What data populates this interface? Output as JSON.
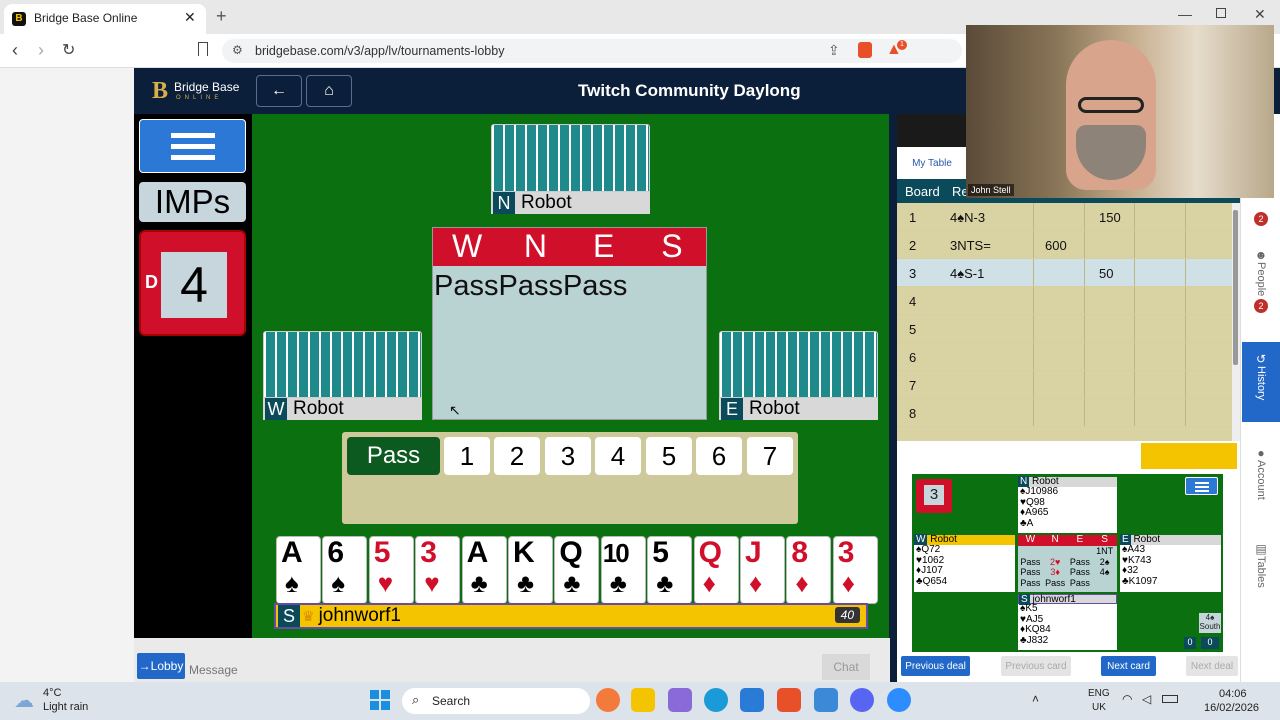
{
  "browser": {
    "tab_title": "Bridge Base Online",
    "url": "bridgebase.com/v3/app/lv/tournaments-lobby",
    "ext_badge": "1"
  },
  "header": {
    "logo": "Bridge Base",
    "logo_sub": "ONLINE",
    "title": "Twitch Community Daylong",
    "back_icon": "←",
    "home_icon": "⌂"
  },
  "left": {
    "scoring": "IMPs",
    "board_number": "4",
    "dealer": "D"
  },
  "table": {
    "north": {
      "seat": "N",
      "name": "Robot"
    },
    "west": {
      "seat": "W",
      "name": "Robot"
    },
    "east": {
      "seat": "E",
      "name": "Robot"
    },
    "south": {
      "seat": "S",
      "name": "johnworf1",
      "score": "40"
    },
    "auction_headers": [
      "W",
      "N",
      "E",
      "S"
    ],
    "auction_text": "PassPassPass"
  },
  "bidbox": {
    "pass": "Pass",
    "levels": [
      "1",
      "2",
      "3",
      "4",
      "5",
      "6",
      "7"
    ]
  },
  "hand": [
    {
      "rank": "A",
      "suit": "♠",
      "color": "blk"
    },
    {
      "rank": "6",
      "suit": "♠",
      "color": "blk"
    },
    {
      "rank": "5",
      "suit": "♥",
      "color": "red"
    },
    {
      "rank": "3",
      "suit": "♥",
      "color": "red"
    },
    {
      "rank": "A",
      "suit": "♣",
      "color": "blk"
    },
    {
      "rank": "K",
      "suit": "♣",
      "color": "blk"
    },
    {
      "rank": "Q",
      "suit": "♣",
      "color": "blk"
    },
    {
      "rank": "10",
      "suit": "♣",
      "color": "blk"
    },
    {
      "rank": "5",
      "suit": "♣",
      "color": "blk"
    },
    {
      "rank": "Q",
      "suit": "♦",
      "color": "red"
    },
    {
      "rank": "J",
      "suit": "♦",
      "color": "red"
    },
    {
      "rank": "8",
      "suit": "♦",
      "color": "red"
    },
    {
      "rank": "3",
      "suit": "♦",
      "color": "red"
    }
  ],
  "bottom": {
    "lobby": "→Lobby",
    "message_placeholder": "Message",
    "chat": "Chat"
  },
  "history": {
    "tab": "My Table",
    "col_board": "Board",
    "col_result": "Re",
    "rows": [
      {
        "board": "1",
        "result": "4♠N-3",
        "ns": "",
        "ew": "150"
      },
      {
        "board": "2",
        "result": "3NTS=",
        "ns": "600",
        "ew": ""
      },
      {
        "board": "3",
        "result": "4♠S-1",
        "ns": "",
        "ew": "50"
      },
      {
        "board": "4",
        "result": "",
        "ns": "",
        "ew": ""
      },
      {
        "board": "5",
        "result": "",
        "ns": "",
        "ew": ""
      },
      {
        "board": "6",
        "result": "",
        "ns": "",
        "ew": ""
      },
      {
        "board": "7",
        "result": "",
        "ns": "",
        "ew": ""
      },
      {
        "board": "8",
        "result": "",
        "ns": "",
        "ew": ""
      }
    ]
  },
  "replay": {
    "board": "3",
    "north": {
      "seat": "N",
      "name": "Robot",
      "lines": [
        "♠J10986",
        "♥Q98",
        "♦A965",
        "♣A"
      ]
    },
    "west": {
      "seat": "W",
      "name": "Robot",
      "lines": [
        "♠Q72",
        "♥1062",
        "♦J107",
        "♣Q654"
      ]
    },
    "east": {
      "seat": "E",
      "name": "Robot",
      "lines": [
        "♠A43",
        "♥K743",
        "♦32",
        "♣K1097"
      ]
    },
    "south": {
      "seat": "S",
      "name": "johnworf1",
      "lines": [
        "♠K5",
        "♥AJ5",
        "♦KQ84",
        "♣J832"
      ]
    },
    "auction_headers": [
      "W",
      "N",
      "E",
      "S"
    ],
    "auction_rows": [
      [
        "",
        "",
        "",
        "1NT"
      ],
      [
        "Pass",
        "2♥",
        "Pass",
        "2♠"
      ],
      [
        "Pass",
        "3♦",
        "Pass",
        "4♠"
      ],
      [
        "Pass",
        "Pass",
        "Pass",
        ""
      ]
    ],
    "contract": "4♠",
    "declarer": "South",
    "tricks_ns": "0",
    "tricks_ew": "0",
    "prev_deal": "Previous deal",
    "prev_card": "Previous card",
    "next_card": "Next card",
    "next_deal": "Next deal"
  },
  "sidetabs": {
    "people": "People",
    "people_badge": "2",
    "history": "History",
    "account": "Account",
    "tables": "Tables",
    "top_badge": "2"
  },
  "webcam": {
    "name": "John Stell"
  },
  "taskbar": {
    "temp": "4°C",
    "weather": "Light rain",
    "search": "Search",
    "lang1": "ENG",
    "lang2": "UK",
    "time": "04:06",
    "date": "16/02/2026"
  },
  "colors": {
    "felt": "#0a7010",
    "navy": "#0c1f3a",
    "bid_red": "#d0102a",
    "namebar_yellow": "#f5c400",
    "history_row": "#d9d2a2",
    "history_selected": "#cfe0e6",
    "accent_blue": "#2168c8"
  }
}
